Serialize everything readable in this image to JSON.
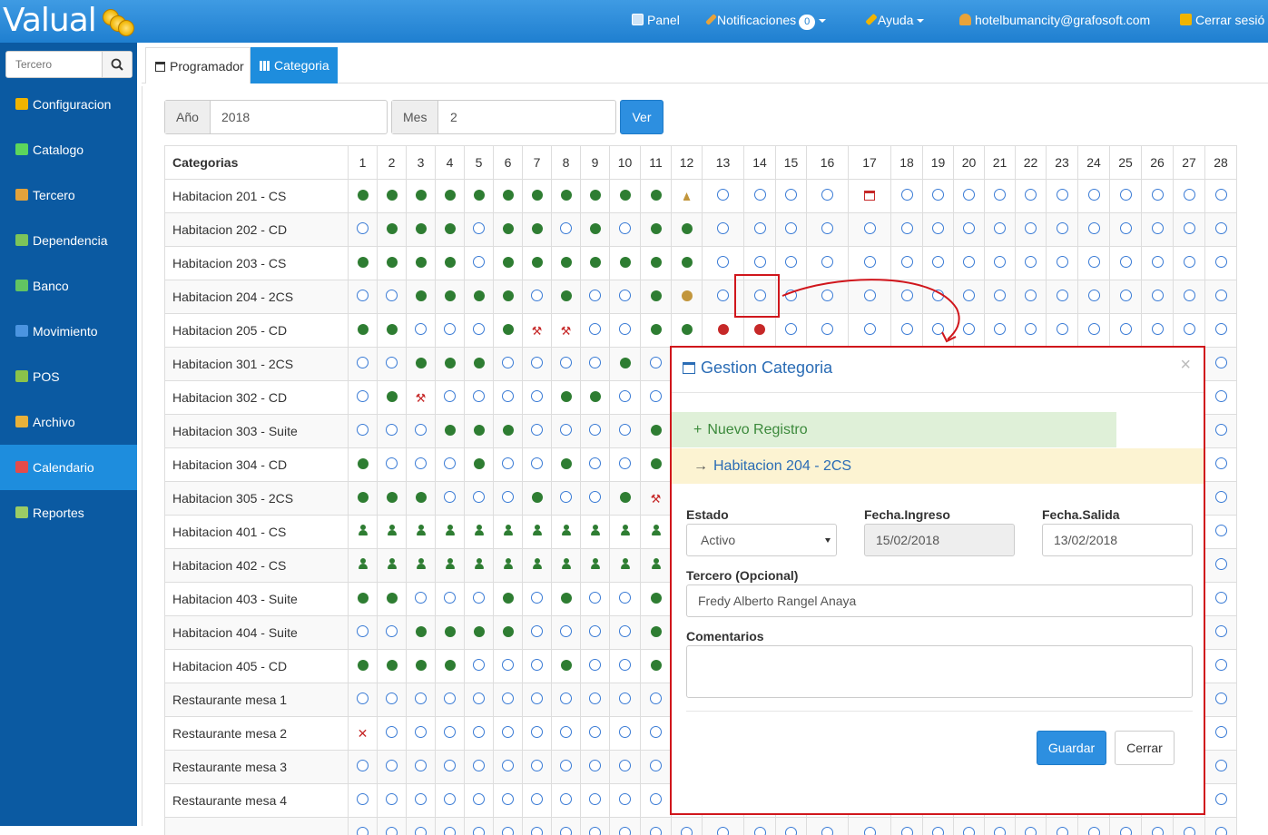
{
  "app": {
    "logo_text": "Valual"
  },
  "topnav": {
    "panel": "Panel",
    "notificaciones": "Notificaciones",
    "notif_count": "0",
    "ayuda": "Ayuda",
    "user": "hotelbumancity@grafosoft.com",
    "logout": "Cerrar sesió"
  },
  "sidebar": {
    "search_placeholder": "Tercero",
    "items": [
      {
        "label": "Configuracion",
        "icon": "gear-icon",
        "color": "#f0b400"
      },
      {
        "label": "Catalogo",
        "icon": "share-icon",
        "color": "#5cd65c"
      },
      {
        "label": "Tercero",
        "icon": "users-icon",
        "color": "#e2a23b"
      },
      {
        "label": "Dependencia",
        "icon": "blocks-icon",
        "color": "#7cc45a"
      },
      {
        "label": "Banco",
        "icon": "money-icon",
        "color": "#62c462"
      },
      {
        "label": "Movimiento",
        "icon": "chart-icon",
        "color": "#4b94e0"
      },
      {
        "label": "POS",
        "icon": "cart-icon",
        "color": "#8bc34a"
      },
      {
        "label": "Archivo",
        "icon": "archive-icon",
        "color": "#e8b13a"
      },
      {
        "label": "Calendario",
        "icon": "calendar-icon",
        "color": "#e34b4b"
      },
      {
        "label": "Reportes",
        "icon": "printer-icon",
        "color": "#9ccc65"
      }
    ],
    "active_index": 8
  },
  "tabs": [
    {
      "label": "Programador"
    },
    {
      "label": "Categoria"
    }
  ],
  "filters": {
    "year_label": "Año",
    "year_value": "2018",
    "month_label": "Mes",
    "month_value": "2",
    "ver_label": "Ver"
  },
  "calendar": {
    "header_label": "Categorias",
    "days": [
      "1",
      "2",
      "3",
      "4",
      "5",
      "6",
      "7",
      "8",
      "9",
      "10",
      "11",
      "12",
      "13",
      "14",
      "15",
      "16",
      "17",
      "18",
      "19",
      "20",
      "21",
      "22",
      "23",
      "24",
      "25",
      "26",
      "27",
      "28"
    ],
    "legend": {
      "F": "occupied",
      "E": "available",
      "R": "reserved",
      "B": "pending",
      "P": "guest",
      "W": "maintenance",
      "X": "blocked",
      "M": "cleaning",
      "C": "scheduled"
    },
    "rows": [
      {
        "name": "Habitacion 201 - CS",
        "cells": "FFFFFFFFFFFMEEEECEEEEEEEEEEE"
      },
      {
        "name": "Habitacion 202 - CD",
        "cells": "EFFFEFFEFEFFEEEEEEEEEEEEEEEE"
      },
      {
        "name": "Habitacion 203 - CS",
        "cells": "FFFFEFFFFFFFEEEEEEEEEEEEEEEE"
      },
      {
        "name": "Habitacion 204 - 2CS",
        "cells": "EEFFFFEFEEFBEEEEEEEEEEEEEEEE"
      },
      {
        "name": "Habitacion 205 - CD",
        "cells": "FFEEEFWWEEFFRREEEEEEEEEEEEEE"
      },
      {
        "name": "Habitacion 301 - 2CS",
        "cells": "EEFFFEEEEFEEEEEEEEEEEEEEEEEE"
      },
      {
        "name": "Habitacion 302 - CD",
        "cells": "EFWEEEEFFEEEEEEEEEEEEEEEEEEE"
      },
      {
        "name": "Habitacion 303 - Suite",
        "cells": "EEEFFFEEEEFEEEEEEEEEEEEEEEEE"
      },
      {
        "name": "Habitacion 304 - CD",
        "cells": "FEEEFEEFEEFEEEEEEEEEEEEEEEEE"
      },
      {
        "name": "Habitacion 305 - 2CS",
        "cells": "FFFEEEFEEFWEEEEEEEEEEEEEEEEE"
      },
      {
        "name": "Habitacion 401 - CS",
        "cells": "PPPPPPPPPPPEEEEEEEEEEEEEEEEE"
      },
      {
        "name": "Habitacion 402 - CS",
        "cells": "PPPPPPPPPPPEEEEEEEEEEEEEEEEE"
      },
      {
        "name": "Habitacion 403 - Suite",
        "cells": "FFEEEFEFEEFEEEEEEEEEEEEEEEEE"
      },
      {
        "name": "Habitacion 404 - Suite",
        "cells": "EEFFFFEEEEFEEEEEEEEEEEEEEEEE"
      },
      {
        "name": "Habitacion 405 - CD",
        "cells": "FFFFEEEFEEFEEEEEEEEEEEEEEEEE"
      },
      {
        "name": "Restaurante mesa 1",
        "cells": "EEEEEEEEEEEEEEEEEEEEEEEEEEEE"
      },
      {
        "name": "Restaurante mesa 2",
        "cells": "XEEEEEEEEEEEEEEEEEEEEEEEEEEE"
      },
      {
        "name": "Restaurante mesa 3",
        "cells": "EEEEEEEEEEEEEEEEEEEEEEEEEEEE"
      },
      {
        "name": "Restaurante mesa 4",
        "cells": "EEEEEEEEEEEEEEEEEEEEEEEEEEEE"
      },
      {
        "name": "",
        "cells": "EEEEEEEEEEEEEEEEEEEEEEEEEEEE"
      }
    ]
  },
  "modal": {
    "title": "Gestion Categoria",
    "close_glyph": "×",
    "new_record": "Nuevo Registro",
    "room": "Habitacion 204 - 2CS",
    "estado_label": "Estado",
    "estado_value": "Activo",
    "ingreso_label": "Fecha.Ingreso",
    "ingreso_value": "15/02/2018",
    "salida_label": "Fecha.Salida",
    "salida_value": "13/02/2018",
    "tercero_label": "Tercero (Opcional)",
    "tercero_value": "Fredy Alberto Rangel Anaya",
    "comentarios_label": "Comentarios",
    "comentarios_value": "",
    "save_label": "Guardar",
    "close_label": "Cerrar"
  },
  "colors": {
    "accent": "#1e8ddd",
    "sidebar": "#0b5aa2",
    "occupied": "#2e7d32",
    "reserved": "#c62828",
    "highlight": "#d0161c"
  }
}
